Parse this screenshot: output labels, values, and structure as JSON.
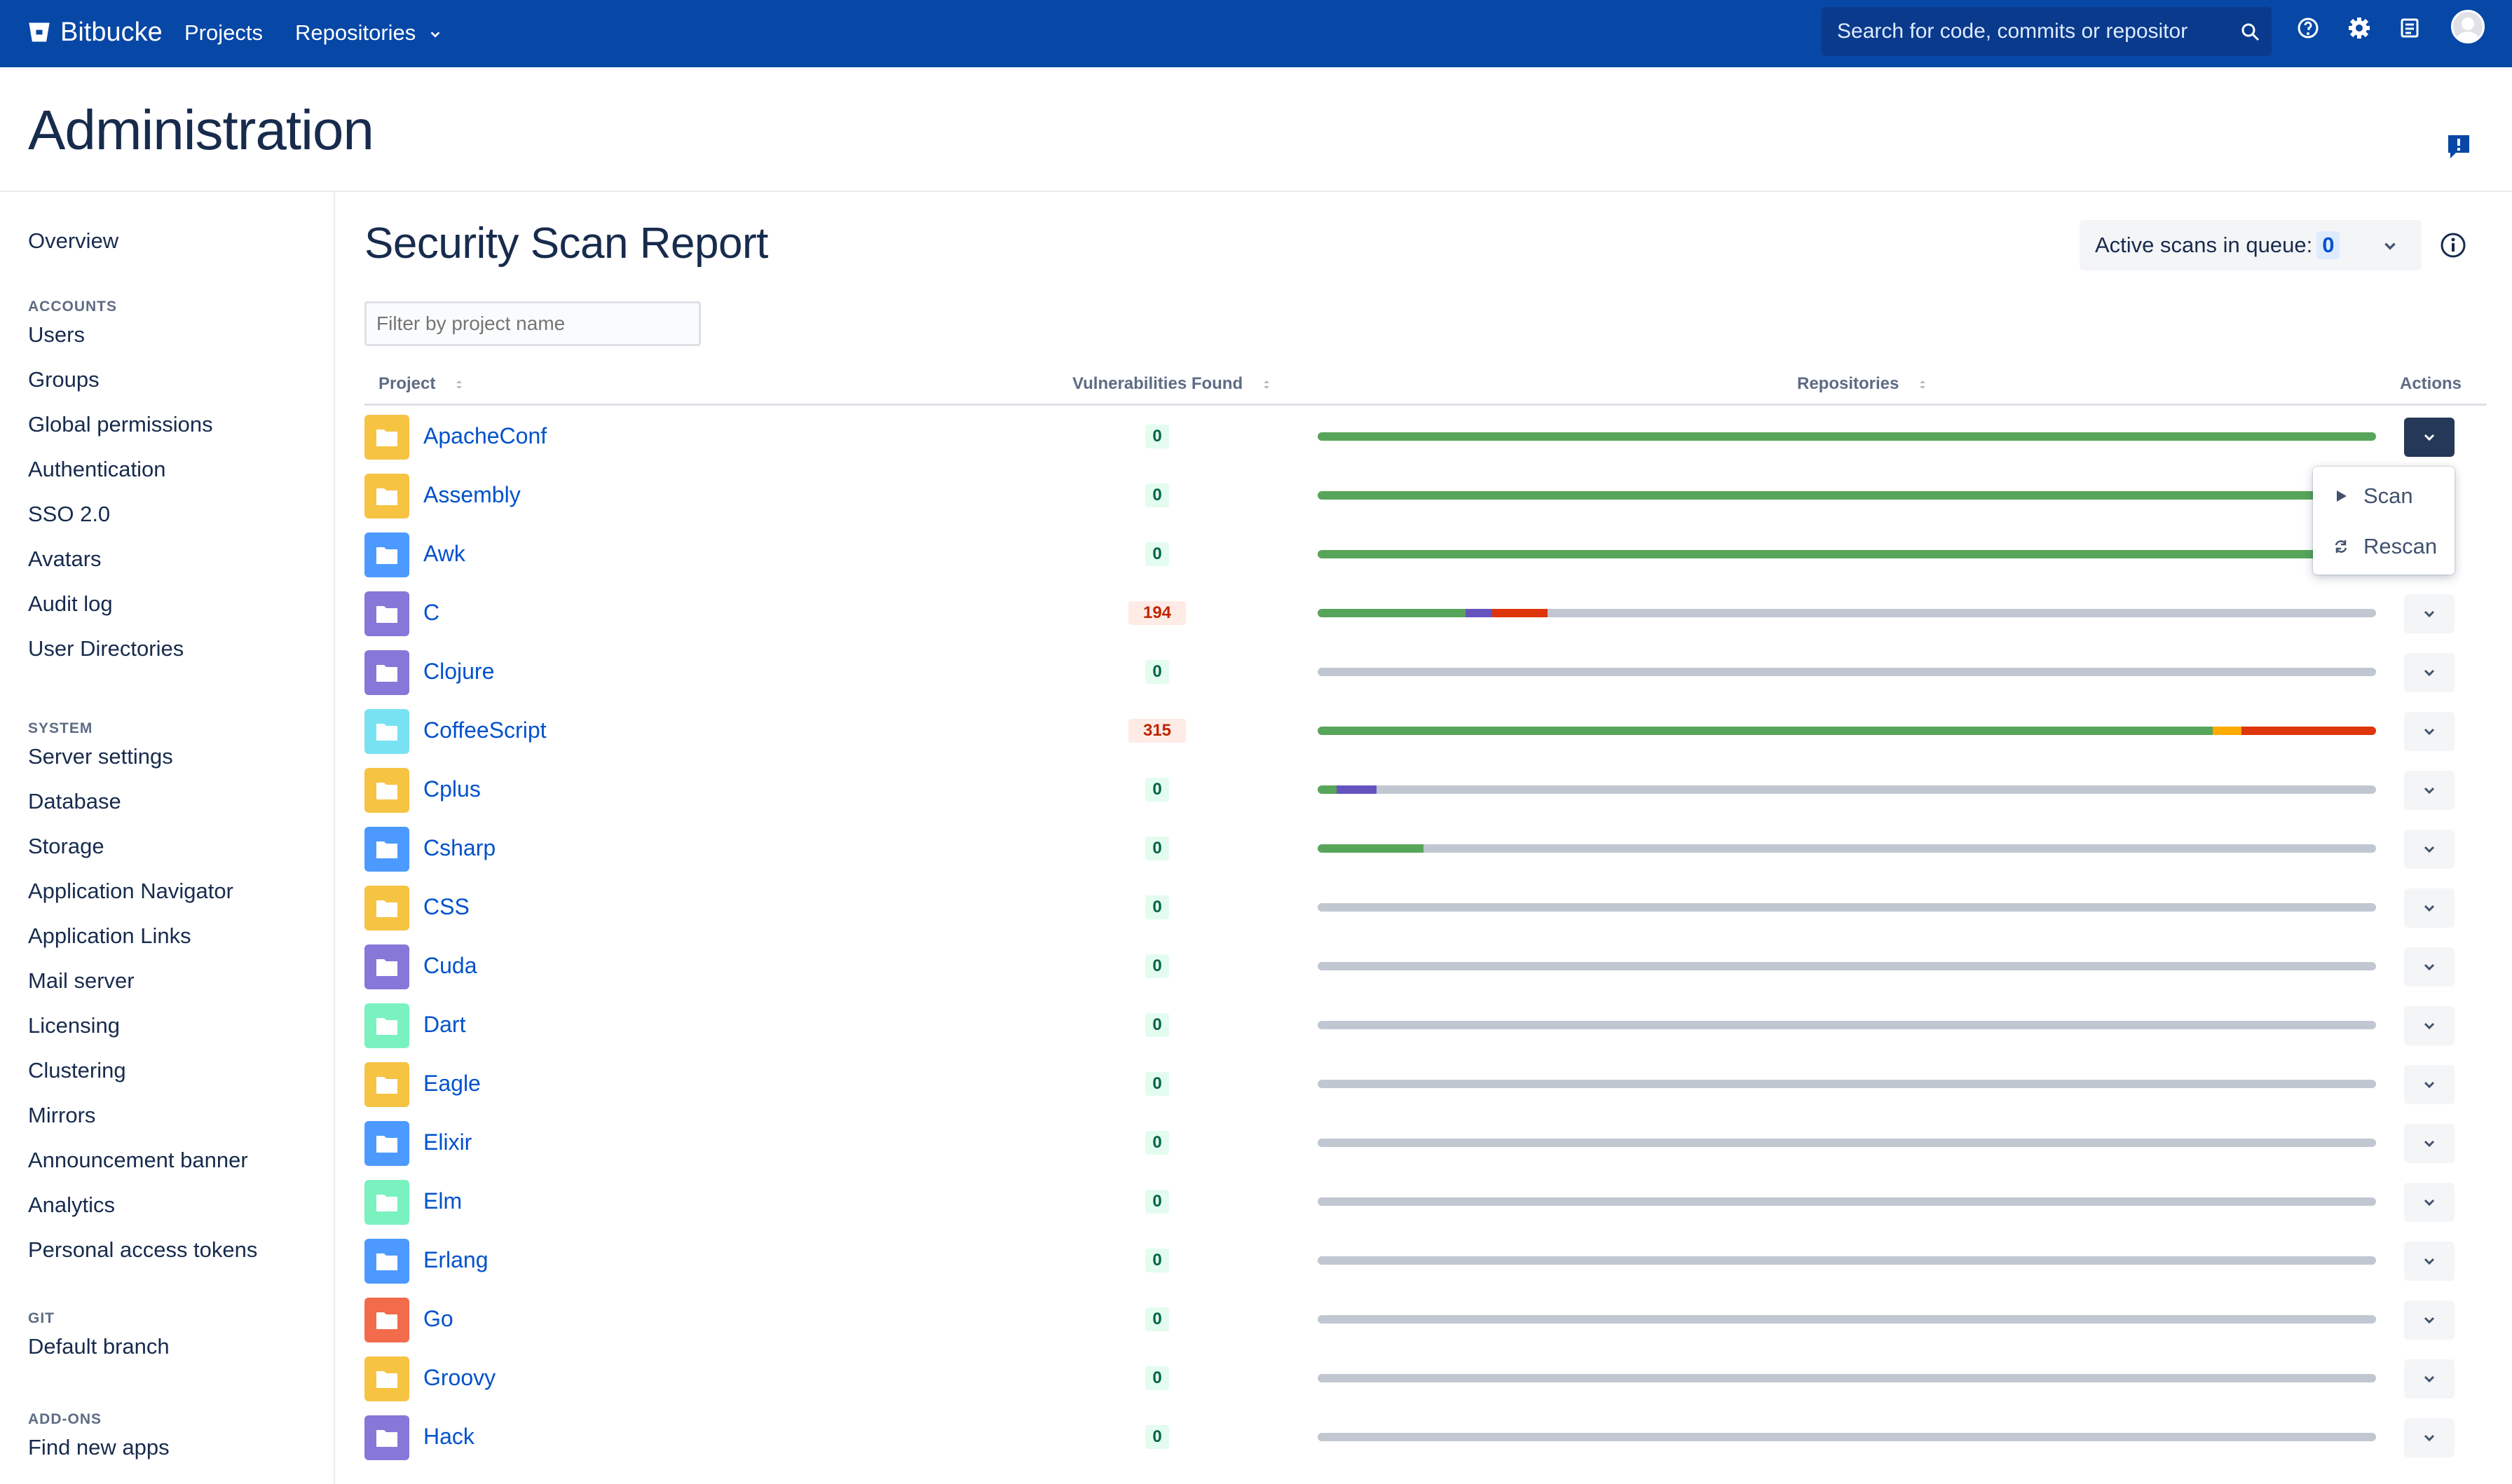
{
  "topnav": {
    "brand": "Bitbucke",
    "projects": "Projects",
    "repositories": "Repositories",
    "search_placeholder": "Search for code, commits or repositor"
  },
  "page": {
    "title": "Administration"
  },
  "sidebar": {
    "overview": "Overview",
    "sections": [
      {
        "heading": "ACCOUNTS",
        "items": [
          "Users",
          "Groups",
          "Global permissions",
          "Authentication",
          "SSO 2.0",
          "Avatars",
          "Audit log",
          "User Directories"
        ]
      },
      {
        "heading": "SYSTEM",
        "items": [
          "Server settings",
          "Database",
          "Storage",
          "Application Navigator",
          "Application Links",
          "Mail server",
          "Licensing",
          "Clustering",
          "Mirrors",
          "Announcement banner",
          "Analytics",
          "Personal access tokens"
        ]
      },
      {
        "heading": "GIT",
        "items": [
          "Default branch"
        ]
      },
      {
        "heading": "ADD-ONS",
        "items": [
          "Find new apps"
        ]
      }
    ]
  },
  "report": {
    "title": "Security Scan Report",
    "queue_label": "Active scans in queue:",
    "queue_count": "0",
    "filter_placeholder": "Filter by project name",
    "columns": {
      "project": "Project",
      "vulnerabilities": "Vulnerabilities Found",
      "repositories": "Repositories",
      "actions": "Actions"
    },
    "dropdown": {
      "scan": "Scan",
      "rescan": "Rescan"
    },
    "colors": {
      "ok": "#57A55A",
      "violet": "#6554C0",
      "red": "#DE350B",
      "orange": "#FFAB00",
      "grey": "#C1C7D0"
    },
    "rows": [
      {
        "name": "ApacheConf",
        "color": "#F6C342",
        "vulns": "0",
        "bar": [
          {
            "c": "ok",
            "f": 1.0
          }
        ]
      },
      {
        "name": "Assembly",
        "color": "#F6C342",
        "vulns": "0",
        "bar": [
          {
            "c": "ok",
            "f": 1.0
          }
        ]
      },
      {
        "name": "Awk",
        "color": "#4C9AFF",
        "vulns": "0",
        "bar": [
          {
            "c": "ok",
            "f": 1.0
          }
        ]
      },
      {
        "name": "C",
        "color": "#8777D9",
        "vulns": "194",
        "bar": [
          {
            "c": "ok",
            "f": 0.14
          },
          {
            "c": "violet",
            "f": 0.025
          },
          {
            "c": "red",
            "f": 0.052
          }
        ]
      },
      {
        "name": "Clojure",
        "color": "#8777D9",
        "vulns": "0",
        "bar": []
      },
      {
        "name": "CoffeeScript",
        "color": "#79E2F2",
        "vulns": "315",
        "bar": [
          {
            "c": "ok",
            "f": 0.846
          },
          {
            "c": "orange",
            "f": 0.027
          },
          {
            "c": "red",
            "f": 0.127
          }
        ]
      },
      {
        "name": "Cplus",
        "color": "#F6C342",
        "vulns": "0",
        "bar": [
          {
            "c": "ok",
            "f": 0.018
          },
          {
            "c": "violet",
            "f": 0.038
          }
        ]
      },
      {
        "name": "Csharp",
        "color": "#4C9AFF",
        "vulns": "0",
        "bar": [
          {
            "c": "ok",
            "f": 0.1
          }
        ]
      },
      {
        "name": "CSS",
        "color": "#F6C342",
        "vulns": "0",
        "bar": []
      },
      {
        "name": "Cuda",
        "color": "#8777D9",
        "vulns": "0",
        "bar": []
      },
      {
        "name": "Dart",
        "color": "#79F2C0",
        "vulns": "0",
        "bar": []
      },
      {
        "name": "Eagle",
        "color": "#F6C342",
        "vulns": "0",
        "bar": []
      },
      {
        "name": "Elixir",
        "color": "#4C9AFF",
        "vulns": "0",
        "bar": []
      },
      {
        "name": "Elm",
        "color": "#79F2C0",
        "vulns": "0",
        "bar": []
      },
      {
        "name": "Erlang",
        "color": "#4C9AFF",
        "vulns": "0",
        "bar": []
      },
      {
        "name": "Go",
        "color": "#F26B4B",
        "vulns": "0",
        "bar": []
      },
      {
        "name": "Groovy",
        "color": "#F6C342",
        "vulns": "0",
        "bar": []
      },
      {
        "name": "Hack",
        "color": "#8777D9",
        "vulns": "0",
        "bar": []
      }
    ]
  }
}
